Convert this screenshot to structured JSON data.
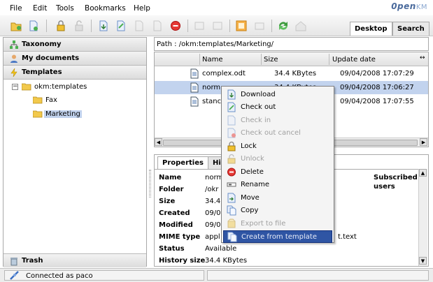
{
  "menu": [
    "File",
    "Edit",
    "Tools",
    "Bookmarks",
    "Help"
  ],
  "logo": {
    "main": "0pen",
    "suffix": "KM"
  },
  "toolbar_tabs": {
    "desktop": "Desktop",
    "search": "Search"
  },
  "sidebar": {
    "taxonomy": "Taxonomy",
    "my_documents": "My documents",
    "templates": "Templates",
    "trash": "Trash",
    "tree": {
      "root": "okm:templates",
      "children": [
        "Fax",
        "Marketing"
      ]
    }
  },
  "path": "Path : /okm:templates/Marketing/",
  "file_list": {
    "columns": [
      "Name",
      "Size",
      "Update date"
    ],
    "rows": [
      {
        "name": "complex.odt",
        "size": "34.4 KBytes",
        "date": "09/04/2008 17:07:29"
      },
      {
        "name": "norm",
        "size": "34.4 KBytes",
        "date": "09/04/2008 17:06:27"
      },
      {
        "name": "stanc",
        "size": "",
        "date": "09/04/2008 17:07:55"
      }
    ]
  },
  "properties": {
    "tabs": [
      "Properties",
      "Hi"
    ],
    "subscribed_header": "Subscribed users",
    "fields": [
      {
        "label": "Name",
        "value": "norm"
      },
      {
        "label": "Folder",
        "value": "/okr"
      },
      {
        "label": "Size",
        "value": "34.4"
      },
      {
        "label": "Created",
        "value": "09/0"
      },
      {
        "label": "Modified",
        "value": "09/0"
      },
      {
        "label": "MIME type",
        "value": "appl"
      },
      {
        "label": "Status",
        "value": "Available"
      },
      {
        "label": "History size",
        "value": "34.4 KBytes"
      }
    ],
    "mime_suffix": "t.text"
  },
  "context_menu": [
    {
      "label": "Download",
      "enabled": true
    },
    {
      "label": "Check out",
      "enabled": true
    },
    {
      "label": "Check in",
      "enabled": false
    },
    {
      "label": "Check out cancel",
      "enabled": false
    },
    {
      "label": "Lock",
      "enabled": true
    },
    {
      "label": "Unlock",
      "enabled": false
    },
    {
      "label": "Delete",
      "enabled": true
    },
    {
      "label": "Rename",
      "enabled": true
    },
    {
      "label": "Move",
      "enabled": true
    },
    {
      "label": "Copy",
      "enabled": true
    },
    {
      "label": "Export to file",
      "enabled": false
    },
    {
      "label": "Create from template",
      "enabled": true,
      "highlighted": true
    }
  ],
  "status": "Connected as paco",
  "colors": {
    "selection": "#c2d3ee",
    "menu_highlight": "#2f55a4",
    "logo": "#4a6a9c"
  }
}
